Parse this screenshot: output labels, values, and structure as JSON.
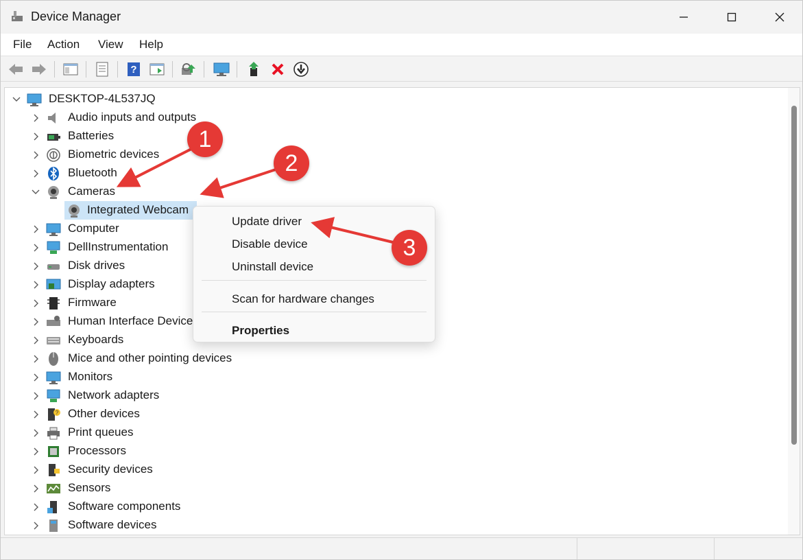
{
  "window": {
    "title": "Device Manager"
  },
  "menu": [
    "File",
    "Action",
    "View",
    "Help"
  ],
  "tree": {
    "root": "DESKTOP-4L537JQ",
    "items": [
      "Audio inputs and outputs",
      "Batteries",
      "Biometric devices",
      "Bluetooth",
      "Cameras",
      "Integrated Webcam",
      "Computer",
      "DellInstrumentation",
      "Disk drives",
      "Display adapters",
      "Firmware",
      "Human Interface Devices",
      "Keyboards",
      "Mice and other pointing devices",
      "Monitors",
      "Network adapters",
      "Other devices",
      "Print queues",
      "Processors",
      "Security devices",
      "Sensors",
      "Software components",
      "Software devices"
    ]
  },
  "context_menu": {
    "update": "Update driver",
    "disable": "Disable device",
    "uninstall": "Uninstall device",
    "scan": "Scan for hardware changes",
    "properties": "Properties"
  },
  "annotations": [
    "1",
    "2",
    "3"
  ],
  "colors": {
    "accent": "#cce4f7",
    "badge": "#e53935",
    "uninstall_x": "#e81123"
  }
}
